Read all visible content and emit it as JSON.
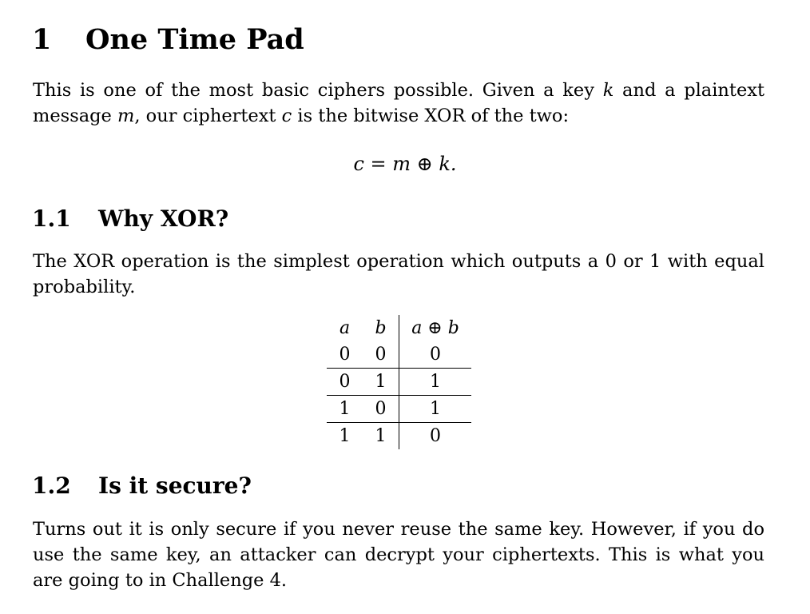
{
  "section1": {
    "number": "1",
    "title": "One Time Pad",
    "para": {
      "t1": "This is one of the most basic ciphers possible. Given a key ",
      "k": "k",
      "t2": " and a plaintext message ",
      "m": "m",
      "t3": ", our ciphertext ",
      "c": "c",
      "t4": " is the bitwise XOR of the two:"
    },
    "equation": "c = m ⊕ k."
  },
  "section1_1": {
    "number": "1.1",
    "title": "Why XOR?",
    "para": "The XOR operation is the simplest operation which outputs a 0 or 1 with equal probability.",
    "table": {
      "headers": [
        "a",
        "b",
        "a ⊕ b"
      ],
      "rows": [
        [
          "0",
          "0",
          "0"
        ],
        [
          "0",
          "1",
          "1"
        ],
        [
          "1",
          "0",
          "1"
        ],
        [
          "1",
          "1",
          "0"
        ]
      ]
    }
  },
  "section1_2": {
    "number": "1.2",
    "title": "Is it secure?",
    "para": "Turns out it is only secure if you never reuse the same key. However, if you do use the same key, an attacker can decrypt your ciphertexts. This is what you are going to in Challenge 4."
  }
}
